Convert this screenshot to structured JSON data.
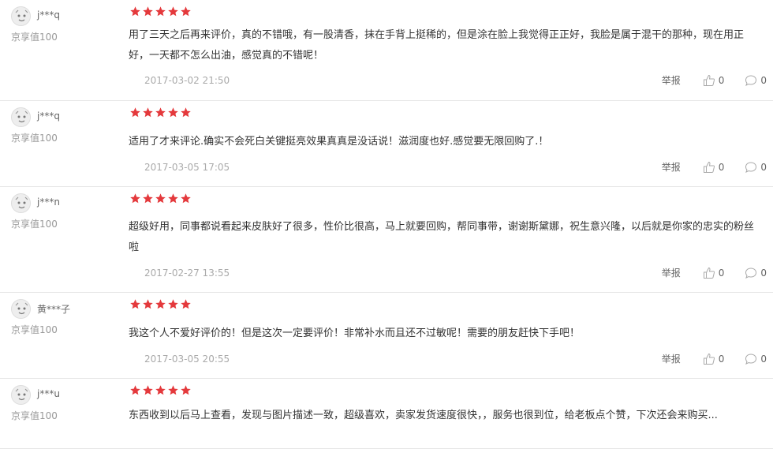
{
  "reviews": [
    {
      "user": "j***q",
      "level": "京享值100",
      "stars": 5,
      "text": "用了三天之后再来评价，真的不错哦，有一股清香，抹在手背上挺稀的，但是涂在脸上我觉得正正好，我脸是属于混干的那种，现在用正好，一天都不怎么出油，感觉真的不错呢！",
      "date": "2017-03-02 21:50",
      "report": "举报",
      "likes": "0",
      "comments": "0"
    },
    {
      "user": "j***q",
      "level": "京享值100",
      "stars": 5,
      "text": "适用了才来评论.确实不会死白关键挺亮效果真真是没话说！滋润度也好.感觉要无限回购了.！",
      "date": "2017-03-05 17:05",
      "report": "举报",
      "likes": "0",
      "comments": "0"
    },
    {
      "user": "j***n",
      "level": "京享值100",
      "stars": 5,
      "text": "超级好用，同事都说看起来皮肤好了很多，性价比很高，马上就要回购，帮同事带，谢谢斯黛娜，祝生意兴隆，以后就是你家的忠实的粉丝啦",
      "date": "2017-02-27 13:55",
      "report": "举报",
      "likes": "0",
      "comments": "0"
    },
    {
      "user": "黄***子",
      "level": "京享值100",
      "stars": 5,
      "text": "我这个人不爱好评价的！但是这次一定要评价！非常补水而且还不过敏呢！需要的朋友赶快下手吧！",
      "date": "2017-03-05 20:55",
      "report": "举报",
      "likes": "0",
      "comments": "0"
    },
    {
      "user": "j***u",
      "level": "京享值100",
      "stars": 5,
      "text": "东西收到以后马上查看，发现与图片描述一致，超级喜欢，卖家发货速度很快，，服务也很到位，给老板点个赞，下次还会来购买...",
      "date": "",
      "report": "",
      "likes": "",
      "comments": ""
    }
  ],
  "colors": {
    "star": "#e4393c",
    "border": "#e6e6e6",
    "meta": "#aaaaaa"
  },
  "icons": {
    "avatar": "default-avatar-icon",
    "star": "star-icon",
    "like": "thumbs-up-icon",
    "comment": "comment-bubble-icon"
  }
}
